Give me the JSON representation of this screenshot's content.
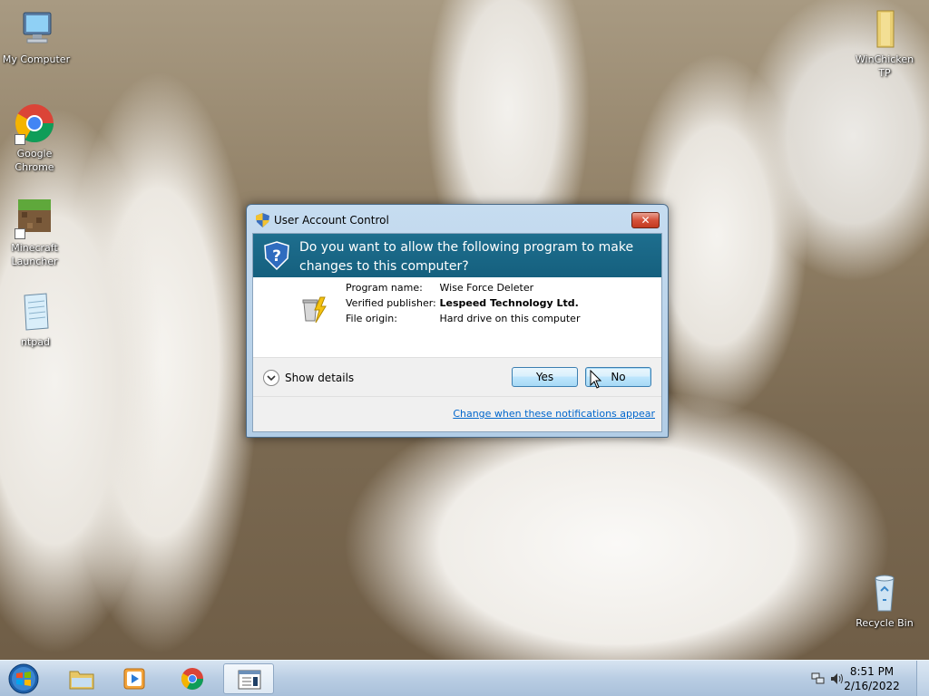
{
  "desktop": {
    "icons": [
      {
        "label": "My Computer"
      },
      {
        "label": "Google Chrome"
      },
      {
        "label": "Minecraft Launcher"
      },
      {
        "label": "ntpad"
      },
      {
        "label": "WinChicken TP"
      },
      {
        "label": "Recycle Bin"
      }
    ]
  },
  "dialog": {
    "title": "User Account Control",
    "close_label": "✕",
    "question": "Do you want to allow the following program to make changes to this computer?",
    "program_name_label": "Program name:",
    "program_name": "Wise Force Deleter",
    "publisher_label": "Verified publisher:",
    "publisher": "Lespeed Technology Ltd.",
    "origin_label": "File origin:",
    "origin": "Hard drive on this computer",
    "show_details": "Show details",
    "yes_label": "Yes",
    "no_label": "No",
    "change_link": "Change when these notifications appear"
  },
  "taskbar": {
    "time": "8:51 PM",
    "date": "2/16/2022"
  },
  "colors": {
    "banner": "#1e6e8e",
    "taskbar": "#b9cde3",
    "link": "#0066cc"
  }
}
